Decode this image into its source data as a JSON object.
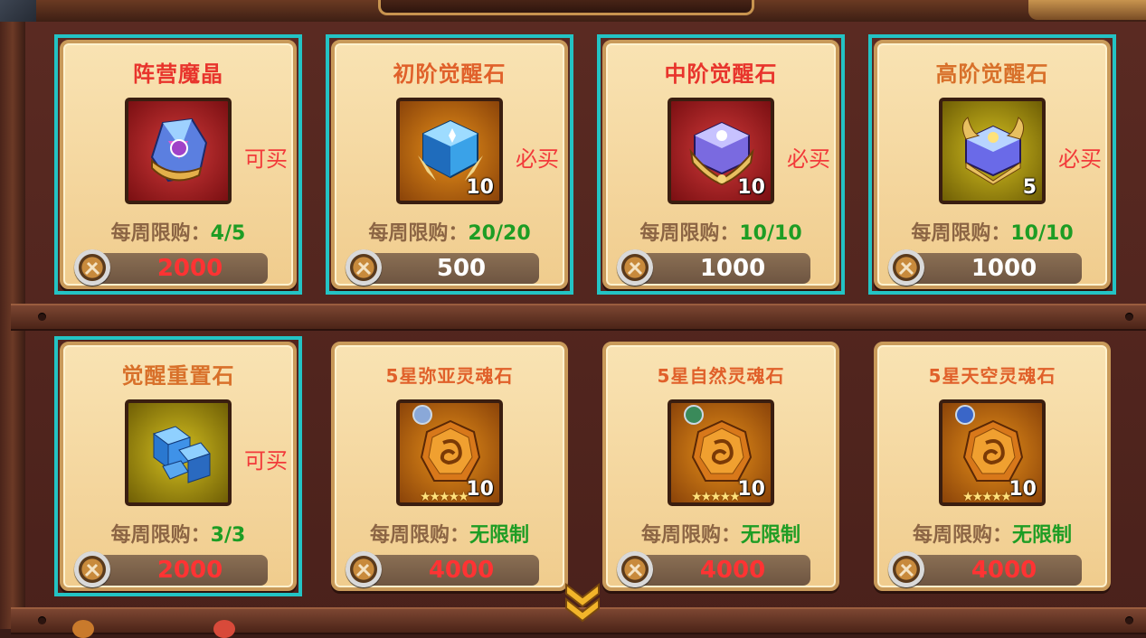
{
  "shop": {
    "items": [
      {
        "title": "阵营魔晶",
        "title_color": "#e8342c",
        "frame": "red",
        "art": "crystal",
        "quantity": "",
        "tag": "可买",
        "limit_label": "每周限购：",
        "limit_value": "4/5",
        "price": "2000",
        "price_color": "red",
        "selected": true
      },
      {
        "title": "初阶觉醒石",
        "title_color": "#e0602a",
        "frame": "orange",
        "art": "cube-blue",
        "quantity": "10",
        "tag": "必买",
        "limit_label": "每周限购：",
        "limit_value": "20/20",
        "price": "500",
        "price_color": "white",
        "selected": true
      },
      {
        "title": "中阶觉醒石",
        "title_color": "#e8342c",
        "frame": "red",
        "art": "cube-purple",
        "quantity": "10",
        "tag": "必买",
        "limit_label": "每周限购：",
        "limit_value": "10/10",
        "price": "1000",
        "price_color": "white",
        "selected": true
      },
      {
        "title": "高阶觉醒石",
        "title_color": "#d8702a",
        "frame": "yellow",
        "art": "cube-gold",
        "quantity": "5",
        "tag": "必买",
        "limit_label": "每周限购：",
        "limit_value": "10/10",
        "price": "1000",
        "price_color": "white",
        "selected": true
      },
      {
        "title": "觉醒重置石",
        "title_color": "#d8702a",
        "frame": "yellow",
        "art": "blocks-blue",
        "quantity": "",
        "tag": "可买",
        "limit_label": "每周限购：",
        "limit_value": "3/3",
        "price": "2000",
        "price_color": "red",
        "selected": true
      },
      {
        "title": "5星弥亚灵魂石",
        "title_color": "#e0602a",
        "frame": "orange",
        "art": "soulstone",
        "badge": "#8aa8d8",
        "quantity": "10",
        "stars": "★★★★★",
        "tag": "",
        "limit_label": "每周限购：",
        "limit_value": "无限制",
        "price": "4000",
        "price_color": "red",
        "selected": false
      },
      {
        "title": "5星自然灵魂石",
        "title_color": "#e0602a",
        "frame": "orange",
        "art": "soulstone",
        "badge": "#3a8a5a",
        "quantity": "10",
        "stars": "★★★★★",
        "tag": "",
        "limit_label": "每周限购：",
        "limit_value": "无限制",
        "price": "4000",
        "price_color": "red",
        "selected": false
      },
      {
        "title": "5星天空灵魂石",
        "title_color": "#e0602a",
        "frame": "orange",
        "art": "soulstone",
        "badge": "#3a66c8",
        "quantity": "10",
        "stars": "★★★★★",
        "tag": "",
        "limit_label": "每周限购：",
        "limit_value": "无限制",
        "price": "4000",
        "price_color": "red",
        "selected": false
      }
    ],
    "currency_icon": "silver-coin-icon",
    "scroll_icon": "double-chevron-down-icon",
    "highlight_color": "#23c3c4"
  }
}
